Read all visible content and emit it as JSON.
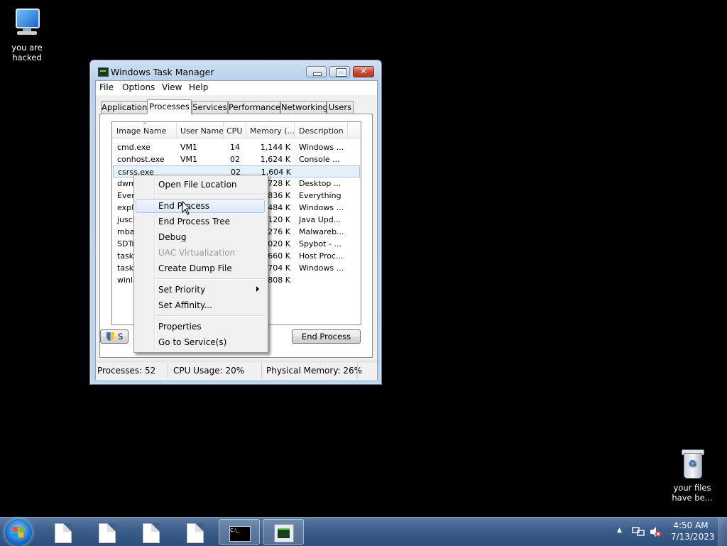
{
  "desktop": {
    "icons": [
      {
        "label": "you are hacked",
        "icon": "computer-icon"
      },
      {
        "label": "your files have be...",
        "icon": "recycle-bin-icon"
      }
    ]
  },
  "window": {
    "title": "Windows Task Manager",
    "close_glyph": "✕",
    "menu": [
      "File",
      "Options",
      "View",
      "Help"
    ],
    "tabs": [
      "Applications",
      "Processes",
      "Services",
      "Performance",
      "Networking",
      "Users"
    ],
    "active_tab": "Processes",
    "columns": [
      "Image Name",
      "User Name",
      "CPU",
      "Memory (...",
      "Description"
    ],
    "rows": [
      {
        "image": "cmd.exe",
        "user": "VM1",
        "cpu": "14",
        "mem": "1,144 K",
        "desc": "Windows ..."
      },
      {
        "image": "conhost.exe",
        "user": "VM1",
        "cpu": "02",
        "mem": "1,624 K",
        "desc": "Console ..."
      },
      {
        "image": "csrss.exe",
        "user": "",
        "cpu": "02",
        "mem": "1,604 K",
        "desc": ""
      },
      {
        "image": "dwm.",
        "user": "",
        "cpu": "",
        "mem": ",728 K",
        "desc": "Desktop ..."
      },
      {
        "image": "Every",
        "user": "",
        "cpu": "",
        "mem": ",836 K",
        "desc": "Everything"
      },
      {
        "image": "explo",
        "user": "",
        "cpu": "",
        "mem": ",484 K",
        "desc": "Windows ..."
      },
      {
        "image": "jusch",
        "user": "",
        "cpu": "",
        "mem": ",120 K",
        "desc": "Java Upd..."
      },
      {
        "image": "mbam",
        "user": "",
        "cpu": "",
        "mem": ",276 K",
        "desc": "Malwareb..."
      },
      {
        "image": "SDTra",
        "user": "",
        "cpu": "",
        "mem": ",020 K",
        "desc": "Spybot - ..."
      },
      {
        "image": "taskh",
        "user": "",
        "cpu": "",
        "mem": ",660 K",
        "desc": "Host Proc..."
      },
      {
        "image": "taskm",
        "user": "",
        "cpu": "",
        "mem": ",704 K",
        "desc": "Windows ..."
      },
      {
        "image": "winlo",
        "user": "",
        "cpu": "",
        "mem": ",808 K",
        "desc": ""
      }
    ],
    "selected_row": "csrss.exe",
    "show_all_button_label": "S",
    "end_process_button": "End Process",
    "status": {
      "processes": "Processes: 52",
      "cpu": "CPU Usage: 20%",
      "memory": "Physical Memory: 26%"
    }
  },
  "context_menu": {
    "items": [
      {
        "label": "Open File Location",
        "state": "normal"
      },
      {
        "label": "End Process",
        "state": "hover"
      },
      {
        "label": "End Process Tree",
        "state": "normal"
      },
      {
        "label": "Debug",
        "state": "normal"
      },
      {
        "label": "UAC Virtualization",
        "state": "disabled"
      },
      {
        "label": "Create Dump File",
        "state": "normal"
      },
      {
        "label": "Set Priority",
        "state": "submenu"
      },
      {
        "label": "Set Affinity...",
        "state": "normal"
      },
      {
        "label": "Properties",
        "state": "normal"
      },
      {
        "label": "Go to Service(s)",
        "state": "normal"
      }
    ]
  },
  "taskbar": {
    "buttons": [
      "document-icon",
      "document-icon",
      "document-icon",
      "document-icon",
      "command-prompt-icon",
      "task-manager-icon"
    ],
    "cmd_glyph": "C:\\_",
    "tray_arrow": "▲",
    "time": "4:50 AM",
    "date": "7/13/2023"
  },
  "colors": {
    "desktop": "#000000",
    "window_frame": "#bed4eb",
    "taskbar": "#3d5f8c",
    "selection": "#e6f0fb"
  }
}
